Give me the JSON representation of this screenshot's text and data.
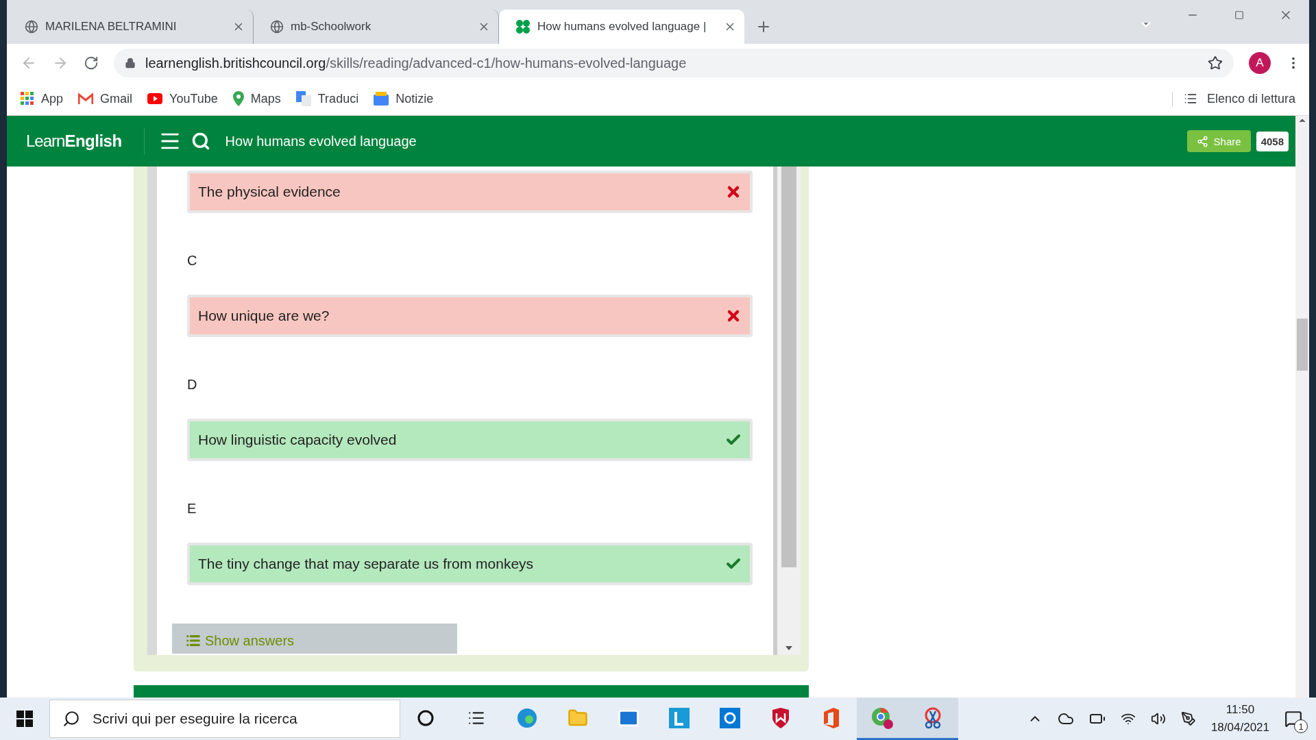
{
  "browser": {
    "tabs": [
      {
        "title": "MARILENA BELTRAMINI",
        "selected": false
      },
      {
        "title": "mb-Schoolwork",
        "selected": false
      },
      {
        "title": "How humans evolved language |",
        "selected": true
      }
    ],
    "url": {
      "host": "learnenglish.britishcouncil.org",
      "path": "/skills/reading/advanced-c1/how-humans-evolved-language"
    },
    "profile_initial": "A",
    "bookmarks": [
      "App",
      "Gmail",
      "YouTube",
      "Maps",
      "Traduci",
      "Notizie"
    ],
    "reading_list": "Elenco di lettura"
  },
  "site_header": {
    "logo_light": "Learn",
    "logo_bold": "English",
    "title": "How humans evolved language",
    "share": "Share",
    "share_count": "4058"
  },
  "quiz": {
    "items": [
      {
        "answer": "The physical evidence",
        "correct": false
      },
      {
        "label": "C",
        "answer": "How unique are we?",
        "correct": false
      },
      {
        "label": "D",
        "answer": "How linguistic capacity evolved",
        "correct": true
      },
      {
        "label": "E",
        "answer": "The tiny change that may separate us from monkeys",
        "correct": true
      }
    ],
    "show_answers": "Show answers"
  },
  "taskbar": {
    "search_placeholder": "Scrivi qui per eseguire la ricerca",
    "time": "11:50",
    "date": "18/04/2021",
    "notification_count": "1"
  }
}
